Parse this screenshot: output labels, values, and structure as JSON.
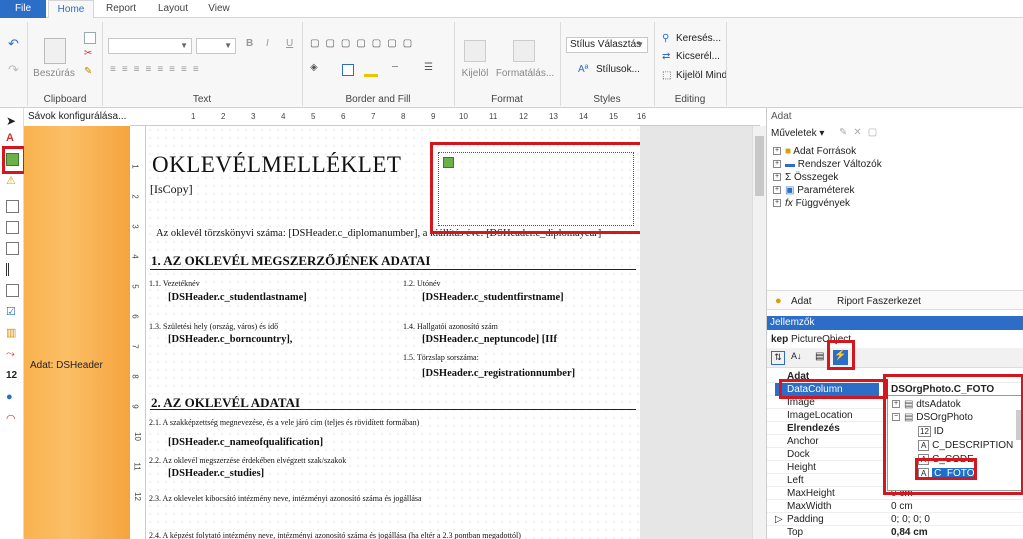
{
  "tabs": {
    "file": "File",
    "home": "Home",
    "report": "Report",
    "layout": "Layout",
    "view": "View"
  },
  "ribbon": {
    "clipboard": {
      "paste": "Beszúrás",
      "label": "Clipboard"
    },
    "text": {
      "label": "Text"
    },
    "border_fill": {
      "label": "Border and Fill"
    },
    "format": {
      "select": "Kijelöl",
      "format_painter": "Formatálás...",
      "label": "Format"
    },
    "styles": {
      "style_combo": "Stílus Választás",
      "styles_button": "Stílusok...",
      "label": "Styles"
    },
    "editing": {
      "find": "Keresés...",
      "replace": "Kicserél...",
      "select_all": "Kijelöl Mind",
      "label": "Editing"
    }
  },
  "bands": {
    "header": "Sávok konfigurálása...",
    "band_label": "Adat: DSHeader"
  },
  "ruler": {
    "h": [
      "1",
      "2",
      "3",
      "4",
      "5",
      "6",
      "7",
      "8",
      "9",
      "10",
      "11",
      "12",
      "13",
      "14",
      "15",
      "16"
    ],
    "v": [
      "1",
      "2",
      "3",
      "4",
      "5",
      "6",
      "7",
      "8",
      "9",
      "10",
      "11",
      "12"
    ]
  },
  "report": {
    "title": "OKLEVÉLMELLÉKLET",
    "iscopy": "[IsCopy]",
    "reg_line": "Az oklevél törzskönyvi száma: [DSHeader.c_diplomanumber], a kiállítás éve: [DSHeader.c_diplomayear]",
    "section1": "1. AZ OKLEVÉL MEGSZERZŐJÉNEK ADATAI",
    "f11": "1.1. Vezetéknév",
    "v11": "[DSHeader.c_studentlastname]",
    "f12": "1.2. Utónév",
    "v12": "[DSHeader.c_studentfirstname]",
    "f13": "1.3. Születési hely (ország, város) és idő",
    "v13": "[DSHeader.c_borncountry],",
    "f14": "1.4. Hallgatói azonosító szám",
    "v14": "[DSHeader.c_neptuncode] [IIf",
    "f15": "1.5. Törzslap sorszáma:",
    "v15": "[DSHeader.c_registrationnumber]",
    "section2": "2. AZ OKLEVÉL ADATAI",
    "f21": "2.1. A szakképzettség megnevezése, és a vele járó cím (teljes és rövidített formában)",
    "v21": "[DSHeader.c_nameofqualification]",
    "f22": "2.2. Az oklevél megszerzése érdekében elvégzett szak/szakok",
    "v22": "[DSHeader.c_studies]",
    "f23": "2.3. Az oklevelet kibocsátó intézmény neve, intézményi azonosító száma és jogállása",
    "f24": "2.4. A képzést folytató intézmény neve, intézményi azonosító száma és jogállása (ha eltér a 2.3 pontban megadottól)"
  },
  "data_panel": {
    "title": "Adat",
    "actions": "Műveletek",
    "items": [
      "Adat Források",
      "Rendszer Változók",
      "Összegek",
      "Paraméterek",
      "Függvények"
    ],
    "tab_data": "Adat",
    "tab_tree": "Riport Faszerkezet"
  },
  "props_panel": {
    "title": "Jellemzők",
    "object_name": "kep",
    "object_type": "PictureObject",
    "category_data": "Adat",
    "category_layout": "Elrendezés",
    "rows": [
      {
        "k": "DataColumn",
        "v": "DSOrgPhoto.C_FOTO"
      },
      {
        "k": "Image",
        "v": ""
      },
      {
        "k": "ImageLocation",
        "v": ""
      },
      {
        "k": "Anchor",
        "v": ""
      },
      {
        "k": "Dock",
        "v": ""
      },
      {
        "k": "Height",
        "v": ""
      },
      {
        "k": "Left",
        "v": ""
      },
      {
        "k": "MaxHeight",
        "v": "0 cm"
      },
      {
        "k": "MaxWidth",
        "v": "0 cm"
      },
      {
        "k": "Padding",
        "v": "0; 0; 0; 0"
      },
      {
        "k": "Top",
        "v": "0,84 cm"
      }
    ],
    "dropdown": [
      "dtsAdatok",
      "DSOrgPhoto",
      "ID",
      "C_DESCRIPTION",
      "C_CODE",
      "C_FOTO"
    ]
  },
  "colors": {
    "accent": "#2b6dc7",
    "highlight": "#d4171e",
    "band": "#f9b24e",
    "selection": "#1f6fc9"
  }
}
